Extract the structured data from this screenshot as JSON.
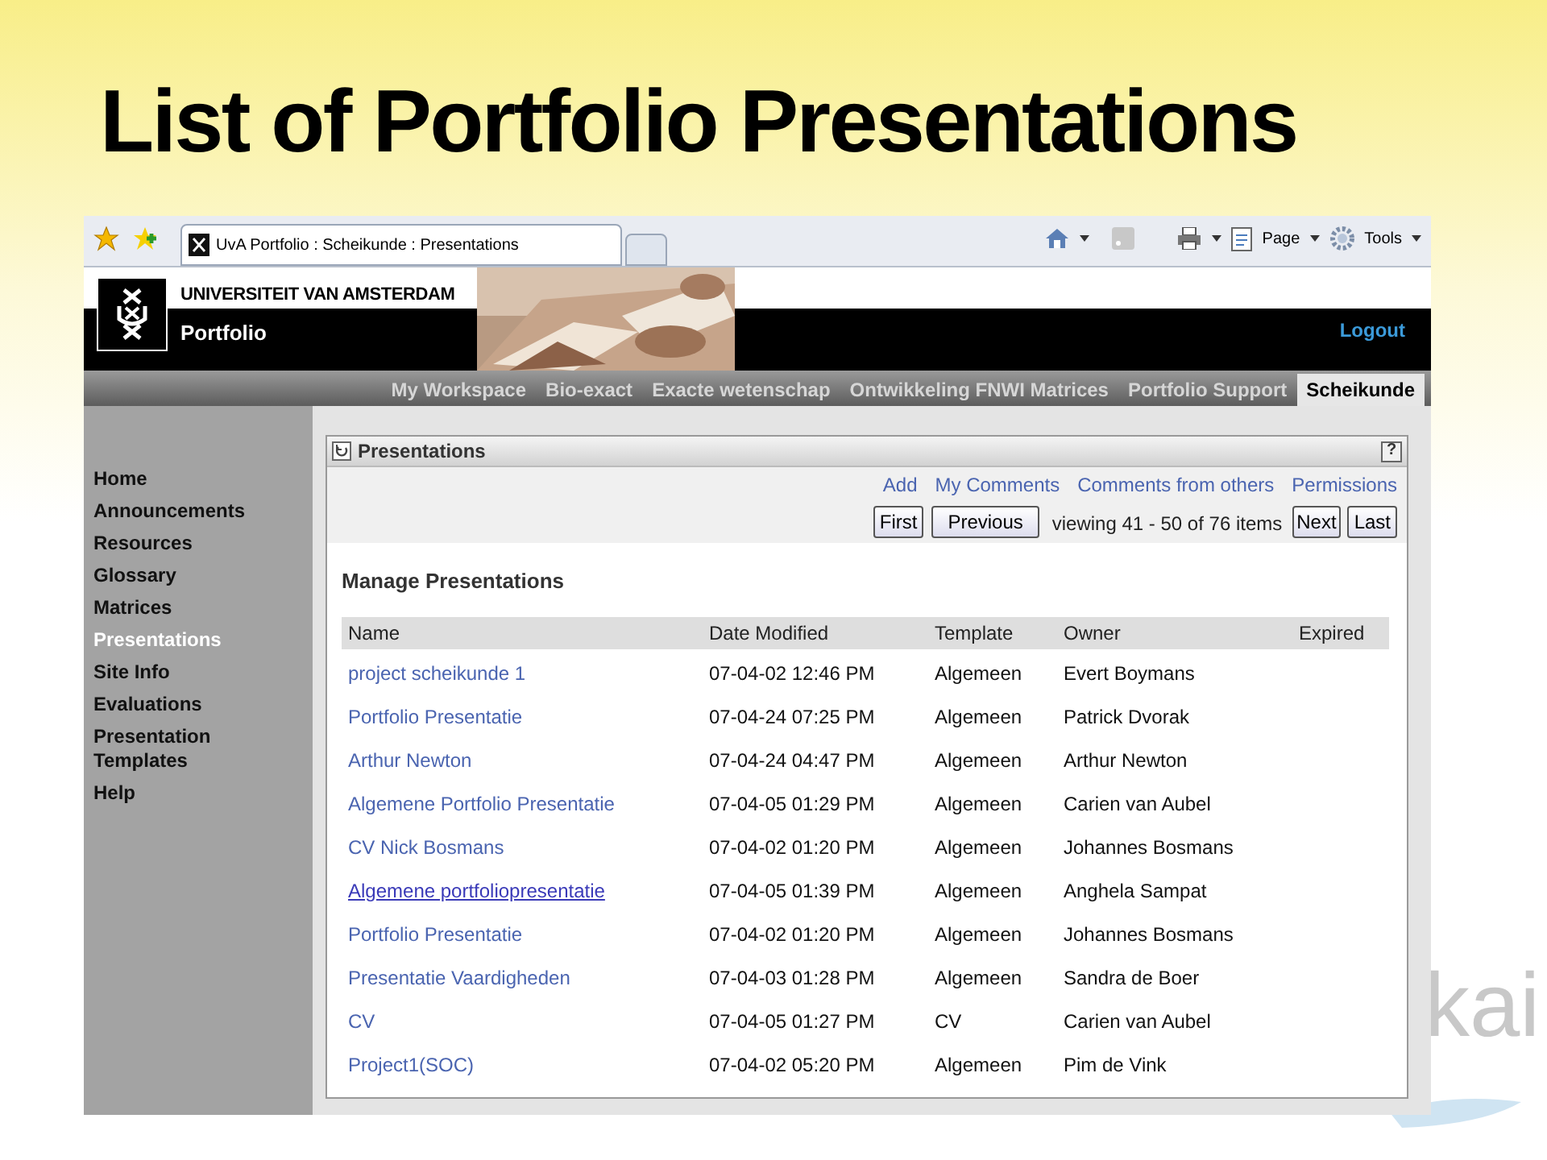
{
  "slide_title": "List of Portfolio Presentations",
  "slide_logo": "kai",
  "browser": {
    "tab_title": "UvA Portfolio : Scheikunde : Presentations",
    "tools": [
      "Page",
      "Tools"
    ]
  },
  "header": {
    "university": "UNIVERSITEIT VAN AMSTERDAM",
    "product": "Portfolio",
    "logout": "Logout"
  },
  "site_tabs": [
    {
      "label": "My Workspace",
      "selected": false
    },
    {
      "label": "Bio-exact",
      "selected": false
    },
    {
      "label": "Exacte wetenschap",
      "selected": false
    },
    {
      "label": "Ontwikkeling FNWI Matrices",
      "selected": false
    },
    {
      "label": "Portfolio Support",
      "selected": false
    },
    {
      "label": "Scheikunde",
      "selected": true
    }
  ],
  "sidebar": {
    "items": [
      {
        "label": "Home",
        "selected": false
      },
      {
        "label": "Announcements",
        "selected": false
      },
      {
        "label": "Resources",
        "selected": false
      },
      {
        "label": "Glossary",
        "selected": false
      },
      {
        "label": "Matrices",
        "selected": false
      },
      {
        "label": "Presentations",
        "selected": true
      },
      {
        "label": "Site Info",
        "selected": false
      },
      {
        "label": "Evaluations",
        "selected": false
      },
      {
        "label": "Presentation Templates",
        "selected": false
      },
      {
        "label": "Help",
        "selected": false
      }
    ]
  },
  "panel": {
    "title": "Presentations",
    "help": "?",
    "actions": [
      "Add",
      "My Comments",
      "Comments from others",
      "Permissions"
    ],
    "pager": {
      "first": "First",
      "previous": "Previous",
      "status": "viewing 41 - 50 of 76 items",
      "next": "Next",
      "last": "Last"
    },
    "heading": "Manage Presentations",
    "table": {
      "columns": [
        "Name",
        "Date Modified",
        "Template",
        "Owner",
        "Expired"
      ],
      "rows": [
        {
          "name": "project scheikunde 1",
          "date": "07-04-02 12:46 PM",
          "template": "Algemeen",
          "owner": "Evert Boymans",
          "hovered": false
        },
        {
          "name": "Portfolio Presentatie",
          "date": "07-04-24 07:25 PM",
          "template": "Algemeen",
          "owner": "Patrick Dvorak",
          "hovered": false
        },
        {
          "name": "Arthur Newton",
          "date": "07-04-24 04:47 PM",
          "template": "Algemeen",
          "owner": "Arthur Newton",
          "hovered": false
        },
        {
          "name": "Algemene Portfolio Presentatie",
          "date": "07-04-05 01:29 PM",
          "template": "Algemeen",
          "owner": "Carien van Aubel",
          "hovered": false
        },
        {
          "name": "CV Nick Bosmans",
          "date": "07-04-02 01:20 PM",
          "template": "Algemeen",
          "owner": "Johannes Bosmans",
          "hovered": false
        },
        {
          "name": "Algemene portfoliopresentatie",
          "date": "07-04-05 01:39 PM",
          "template": "Algemeen",
          "owner": "Anghela Sampat",
          "hovered": true
        },
        {
          "name": "Portfolio Presentatie",
          "date": "07-04-02 01:20 PM",
          "template": "Algemeen",
          "owner": "Johannes Bosmans",
          "hovered": false
        },
        {
          "name": "Presentatie Vaardigheden",
          "date": "07-04-03 01:28 PM",
          "template": "Algemeen",
          "owner": "Sandra de Boer",
          "hovered": false
        },
        {
          "name": "CV",
          "date": "07-04-05 01:27 PM",
          "template": "CV",
          "owner": "Carien van Aubel",
          "hovered": false
        },
        {
          "name": "Project1(SOC)",
          "date": "07-04-02 05:20 PM",
          "template": "Algemeen",
          "owner": "Pim de Vink",
          "hovered": false
        }
      ]
    }
  }
}
